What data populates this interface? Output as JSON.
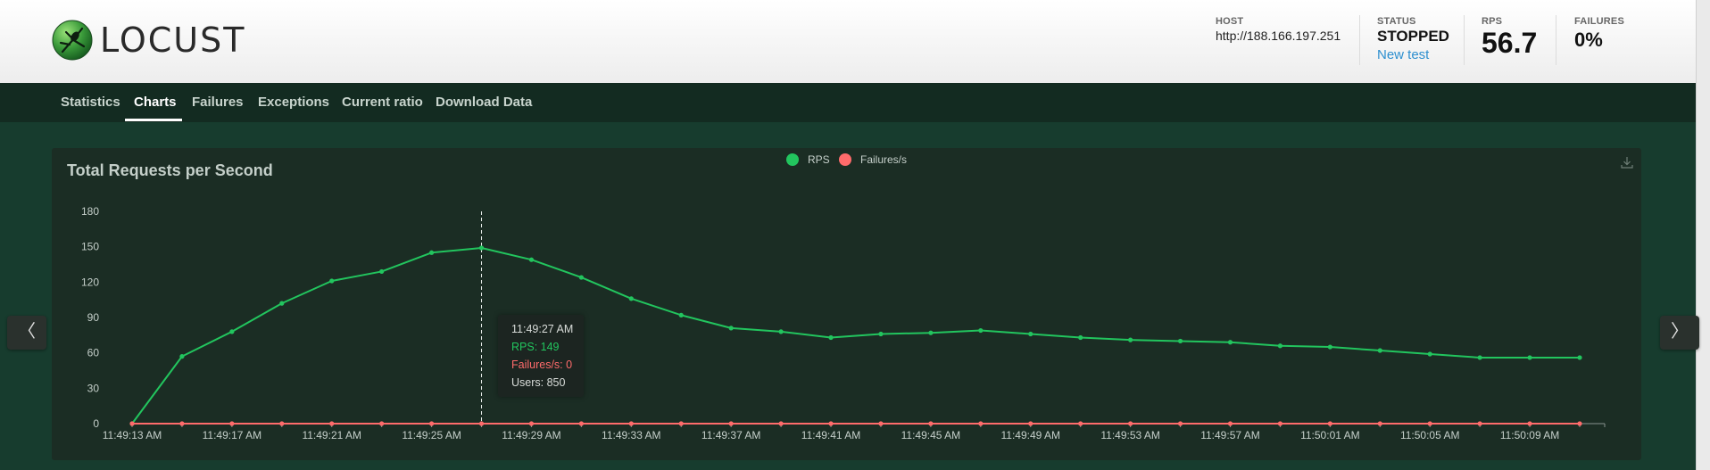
{
  "brand": {
    "name": "LOCUST",
    "logo_icon": "locust-logo-icon"
  },
  "header": {
    "host": {
      "label": "HOST",
      "value": "http://188.166.197.251"
    },
    "status": {
      "label": "STATUS",
      "value": "STOPPED",
      "link": "New test"
    },
    "rps": {
      "label": "RPS",
      "value": "56.7"
    },
    "failures": {
      "label": "FAILURES",
      "value": "0%"
    }
  },
  "tabs": [
    {
      "label": "Statistics",
      "active": false
    },
    {
      "label": "Charts",
      "active": true
    },
    {
      "label": "Failures",
      "active": false
    },
    {
      "label": "Exceptions",
      "active": false
    },
    {
      "label": "Current ratio",
      "active": false
    },
    {
      "label": "Download Data",
      "active": false
    }
  ],
  "nav_buttons": {
    "prev": "〈",
    "next": "〉"
  },
  "colors": {
    "rps": "#22c55e",
    "failures": "#ff6b6b",
    "accent": "#2d8fcf"
  },
  "tooltip": {
    "time": "11:49:27 AM",
    "rps": "RPS: 149",
    "failures": "Failures/s: 0",
    "users": "Users: 850"
  },
  "chart_data": {
    "type": "line",
    "title": "Total Requests per Second",
    "legend_position": "top-center",
    "ylim": [
      0,
      180
    ],
    "yticks": [
      0,
      30,
      60,
      90,
      120,
      150,
      180
    ],
    "x": [
      "11:49:13 AM",
      "11:49:15 AM",
      "11:49:17 AM",
      "11:49:19 AM",
      "11:49:21 AM",
      "11:49:23 AM",
      "11:49:25 AM",
      "11:49:27 AM",
      "11:49:29 AM",
      "11:49:31 AM",
      "11:49:33 AM",
      "11:49:35 AM",
      "11:49:37 AM",
      "11:49:39 AM",
      "11:49:41 AM",
      "11:49:43 AM",
      "11:49:45 AM",
      "11:49:47 AM",
      "11:49:49 AM",
      "11:49:51 AM",
      "11:49:53 AM",
      "11:49:55 AM",
      "11:49:57 AM",
      "11:49:59 AM",
      "11:50:01 AM",
      "11:50:03 AM",
      "11:50:05 AM",
      "11:50:07 AM",
      "11:50:09 AM",
      "11:50:11 AM"
    ],
    "xtick_labels": [
      "11:49:13 AM",
      "11:49:17 AM",
      "11:49:21 AM",
      "11:49:25 AM",
      "11:49:29 AM",
      "11:49:33 AM",
      "11:49:37 AM",
      "11:49:41 AM",
      "11:49:45 AM",
      "11:49:49 AM",
      "11:49:53 AM",
      "11:49:57 AM",
      "11:50:01 AM",
      "11:50:05 AM",
      "11:50:09 AM"
    ],
    "series": [
      {
        "name": "RPS",
        "values": [
          0,
          57,
          78,
          102,
          121,
          129,
          145,
          149,
          139,
          124,
          106,
          92,
          81,
          78,
          73,
          76,
          77,
          79,
          76,
          73,
          71,
          70,
          69,
          66,
          65,
          62,
          59,
          56,
          56,
          56
        ]
      },
      {
        "name": "Failures/s",
        "values": [
          0,
          0,
          0,
          0,
          0,
          0,
          0,
          0,
          0,
          0,
          0,
          0,
          0,
          0,
          0,
          0,
          0,
          0,
          0,
          0,
          0,
          0,
          0,
          0,
          0,
          0,
          0,
          0,
          0,
          0
        ]
      }
    ],
    "hover_index": 7
  }
}
